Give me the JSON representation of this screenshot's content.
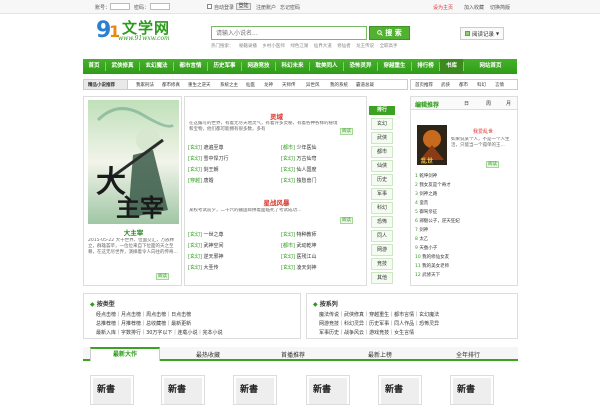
{
  "topbar": {
    "account_label": "账号：",
    "password_label": "密码：",
    "auto_login": "自动登录",
    "login": "登陆",
    "register": "注册账户",
    "forgot": "忘记密码",
    "set_home": "设为主页",
    "add_fav": "加入收藏",
    "clear_mode": "切换简版"
  },
  "logo": {
    "title": "文学网",
    "url": "www.91wxw.com"
  },
  "search": {
    "placeholder": "请输入小说名...",
    "button": "搜 索",
    "hot_label": "热门搜索：",
    "hot": [
      "秘籍录播",
      "乡村小医师",
      "绿色江湖",
      "仙界大道",
      "修仙者",
      "龙王传说",
      "全职高手"
    ]
  },
  "reading_record": "阅读记录",
  "nav": {
    "items": [
      "首页",
      "武侠修真",
      "玄幻魔法",
      "都市言情",
      "历史军事",
      "网游竞技",
      "科幻未来",
      "耽美同人",
      "恐怖灵异",
      "穿越重生",
      "排行榜",
      "书库",
      "网站首页"
    ]
  },
  "subnav": {
    "items": [
      "精品小说推荐",
      "我家刑法",
      "都市修真",
      "重生之逆天",
      "系统之主",
      "仙医",
      "龙神",
      "天师传",
      "异世风",
      "我的系统",
      "霸道总裁"
    ],
    "right_items": [
      "首页推荐",
      "武侠",
      "都市",
      "科幻",
      "言情"
    ]
  },
  "featured_left": {
    "title": "大主宰",
    "desc": "2015-05-22 大千世界，位面交汇，万族林立，群雄荟萃，一位位来自下位面的天之至尊，在这无尽世界，演绎着令人向往的传奇...",
    "read": "阅读"
  },
  "block1": {
    "title": "灵域",
    "desc": "在这编写的世界，有着无尽天地灵气，有着许多灵秘，有着各种各样的秘境和宝物，他们都可能拥有很多数，多有",
    "read": "阅读",
    "rows": [
      {
        "t1": "[玄幻]",
        "b1": "遮遍至尊",
        "t2": "[都市]",
        "b2": "少年医仙"
      },
      {
        "t1": "[玄幻]",
        "b1": "雪中悍刀行",
        "t2": "[玄幻]",
        "b2": "万古仙穹"
      },
      {
        "t1": "[玄幻]",
        "b1": "剑王朝",
        "t2": "[玄幻]",
        "b2": "仙人国度"
      },
      {
        "t1": "[穿越]",
        "b1": "唐婚",
        "t2": "[玄幻]",
        "b2": "独愁兽门"
      }
    ]
  },
  "block2": {
    "title": "星战风暴",
    "desc": "某校考试前夕，二十六的疆国郎拼着面临死了考试成功...",
    "read": "阅读",
    "rows": [
      {
        "t1": "[玄幻]",
        "b1": "一世之尊",
        "t2": "[玄幻]",
        "b2": "特种教师"
      },
      {
        "t1": "[玄幻]",
        "b1": "武神空间",
        "t2": "[都市]",
        "b2": "武动乾坤"
      },
      {
        "t1": "[玄幻]",
        "b1": "逆天邪神",
        "t2": "[玄幻]",
        "b2": "医残江山"
      },
      {
        "t1": "[玄幻]",
        "b1": "大圣传",
        "t2": "[玄幻]",
        "b2": "凌天剑神"
      }
    ]
  },
  "mid_side": {
    "header": "排行",
    "items": [
      "玄幻",
      "武侠",
      "都市",
      "仙侠",
      "历史",
      "军事",
      "科幻",
      "恐怖",
      "同人",
      "网游",
      "竞技",
      "其他"
    ]
  },
  "editor": {
    "title": "编辑推荐",
    "tabs": [
      "日",
      "周",
      "月"
    ],
    "book_title": "我爱乱世",
    "book_desc": "如果说某个人，不是一个人生活，只能当一个孤单的王...",
    "read": "阅读",
    "list": [
      {
        "n": "1",
        "t": "乾坤剑神"
      },
      {
        "n": "2",
        "t": "我女友是个奇才"
      },
      {
        "n": "3",
        "t": "剑神之路"
      },
      {
        "n": "4",
        "t": "蛮荒"
      },
      {
        "n": "5",
        "t": "御驾亲征"
      },
      {
        "n": "6",
        "t": "邪魅公子，逆天狂妃"
      },
      {
        "n": "7",
        "t": "剑神"
      },
      {
        "n": "8",
        "t": "太乙"
      },
      {
        "n": "9",
        "t": "天蚕小子"
      },
      {
        "n": "10",
        "t": "我的修仙女友"
      },
      {
        "n": "11",
        "t": "我的美女老师"
      },
      {
        "n": "12",
        "t": "武修天下"
      }
    ]
  },
  "by_type": {
    "title": "按类型",
    "rows": [
      [
        "经点击榜",
        "月点击榜",
        "周点击榜",
        "日点击榜"
      ],
      [
        "总推荐榜",
        "月推荐榜",
        "总收藏榜",
        "最新更新"
      ],
      [
        "最新入库",
        "字数排行",
        "30万字以下",
        "连载小说",
        "完本小说"
      ]
    ]
  },
  "by_series": {
    "title": "按系列",
    "rows": [
      [
        "魔法传说",
        "武侠修真",
        "穿越重生",
        "都市言情",
        "玄幻魔法"
      ],
      [
        "网游竞技",
        "科幻灵异",
        "历史军事",
        "同人作品",
        "恐怖灵异"
      ],
      [
        "军事历史",
        "战争风云",
        "游戏竞技",
        "女生言情"
      ]
    ]
  },
  "bottom_tabs": [
    "最新大作",
    "最热收藏",
    "首播推荐",
    "最新上榜",
    "全年排行"
  ],
  "thumbs": [
    "新書",
    "新書",
    "新書",
    "新書",
    "新書",
    "新書"
  ]
}
